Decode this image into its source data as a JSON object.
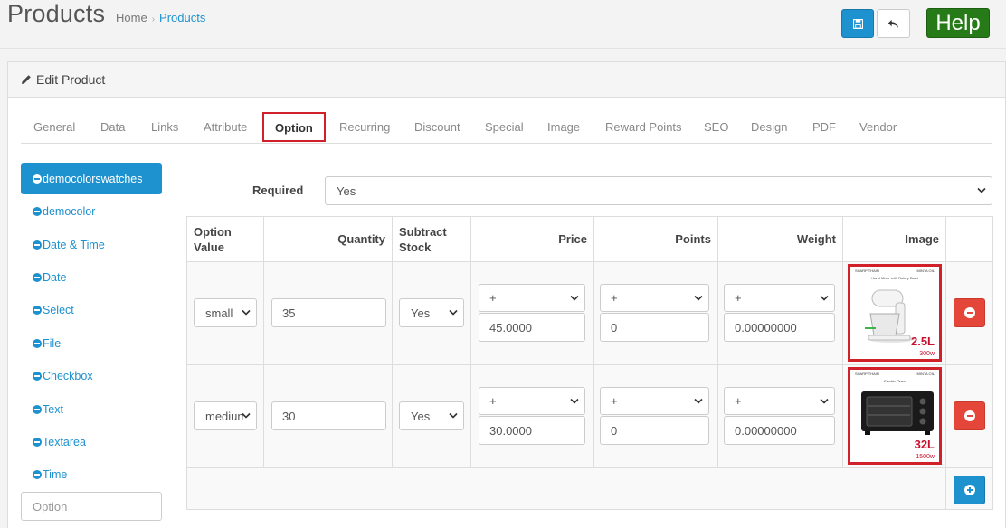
{
  "header": {
    "title": "Products",
    "breadcrumb": [
      "Home",
      "Products"
    ],
    "help_label": "Help"
  },
  "panel": {
    "heading": "Edit Product"
  },
  "tabs": [
    "General",
    "Data",
    "Links",
    "Attribute",
    "Option",
    "Recurring",
    "Discount",
    "Special",
    "Image",
    "Reward Points",
    "SEO",
    "Design",
    "PDF",
    "Vendor"
  ],
  "active_tab": "Option",
  "options": {
    "items": [
      "democolorswatches",
      "democolor",
      "Date & Time",
      "Date",
      "Select",
      "File",
      "Checkbox",
      "Text",
      "Textarea",
      "Time"
    ],
    "active": "democolorswatches",
    "input_placeholder": "Option"
  },
  "required": {
    "label": "Required",
    "value": "Yes"
  },
  "table": {
    "headers": {
      "option_value": "Option Value",
      "quantity": "Quantity",
      "subtract": "Subtract Stock",
      "price": "Price",
      "points": "Points",
      "weight": "Weight",
      "image": "Image"
    },
    "rows": [
      {
        "option_value": "small",
        "quantity": "35",
        "subtract": "Yes",
        "price_prefix": "+",
        "price": "45.0000",
        "points_prefix": "+",
        "points": "0",
        "weight_prefix": "+",
        "weight": "0.00000000",
        "image": {
          "brand": "SHARP THAIN",
          "brand2": "MINTA OIL",
          "subtitle": "Hand Mixer with Rotary Bowl",
          "capacity": "2.5L",
          "watt": "300w",
          "icon": "stand-mixer-image"
        }
      },
      {
        "option_value": "medium",
        "quantity": "30",
        "subtract": "Yes",
        "price_prefix": "+",
        "price": "30.0000",
        "points_prefix": "+",
        "points": "0",
        "weight_prefix": "+",
        "weight": "0.00000000",
        "image": {
          "brand": "SHARP THAIN",
          "brand2": "MINTA OIL",
          "subtitle": "Electric Oven",
          "capacity": "32L",
          "watt": "1500w",
          "icon": "electric-oven-image"
        }
      }
    ]
  },
  "colors": {
    "primary": "#1e91cf",
    "danger": "#e4473a",
    "help": "#267a18",
    "highlight": "#d0202a"
  }
}
